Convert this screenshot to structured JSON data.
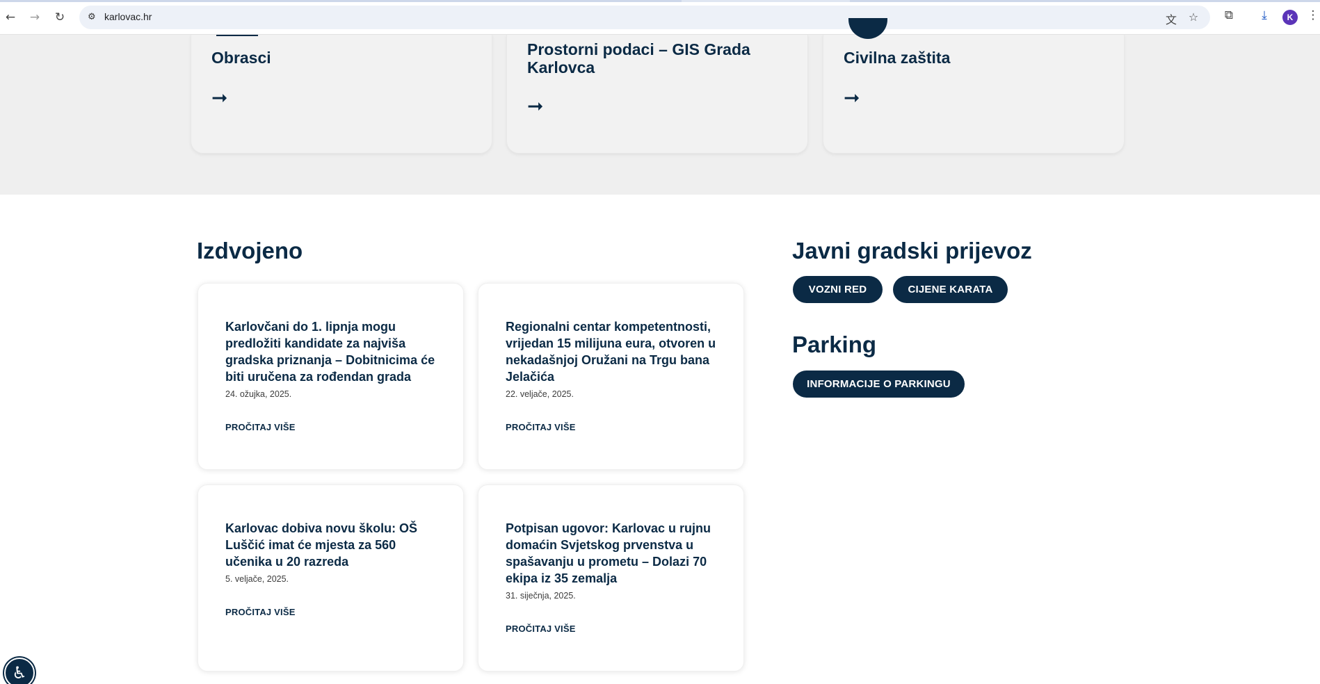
{
  "browser": {
    "url": "karlovac.hr",
    "avatar_letter": "K",
    "icons": [
      "back-icon",
      "forward-icon",
      "reload-icon",
      "site-settings-icon",
      "translate-icon",
      "bookmark-star-icon",
      "extensions-icon",
      "download-icon",
      "menu-icon"
    ]
  },
  "tiles": [
    {
      "title": "Obrasci",
      "arrow": "➞"
    },
    {
      "title": "Prostorni podaci – GIS Grada Karlovca",
      "arrow": "➞"
    },
    {
      "title": "Civilna zaštita",
      "arrow": "➞"
    }
  ],
  "featured": {
    "heading": "Izdvojeno",
    "cards": [
      {
        "title": "Karlovčani do 1. lipnja mogu predložiti kandidate za najviša gradska priznanja – Dobitnicima će biti uručena za rođendan grada",
        "date": "24. ožujka, 2025.",
        "more": "PROČITAJ VIŠE"
      },
      {
        "title": "Regionalni centar kompetentnosti, vrijedan 15 milijuna eura, otvoren u nekadašnjoj Oružani na Trgu bana Jelačića",
        "date": "22. veljače, 2025.",
        "more": "PROČITAJ VIŠE"
      },
      {
        "title": "Karlovac dobiva novu školu: OŠ Luščić imat će mjesta za 560 učenika u 20 razreda",
        "date": "5. veljače, 2025.",
        "more": "PROČITAJ VIŠE"
      },
      {
        "title": "Potpisan ugovor: Karlovac u rujnu domaćin Svjetskog prvenstva u spašavanju u prometu – Dolazi 70 ekipa iz 35 zemalja",
        "date": "31. siječnja, 2025.",
        "more": "PROČITAJ VIŠE"
      }
    ]
  },
  "transport": {
    "heading": "Javni gradski prijevoz",
    "buttons": [
      "VOZNI RED",
      "CIJENE KARATA"
    ]
  },
  "parking": {
    "heading": "Parking",
    "button": "INFORMACIJE O PARKINGU"
  },
  "colors": {
    "brand": "#0b2a45",
    "band": "#efefef"
  }
}
